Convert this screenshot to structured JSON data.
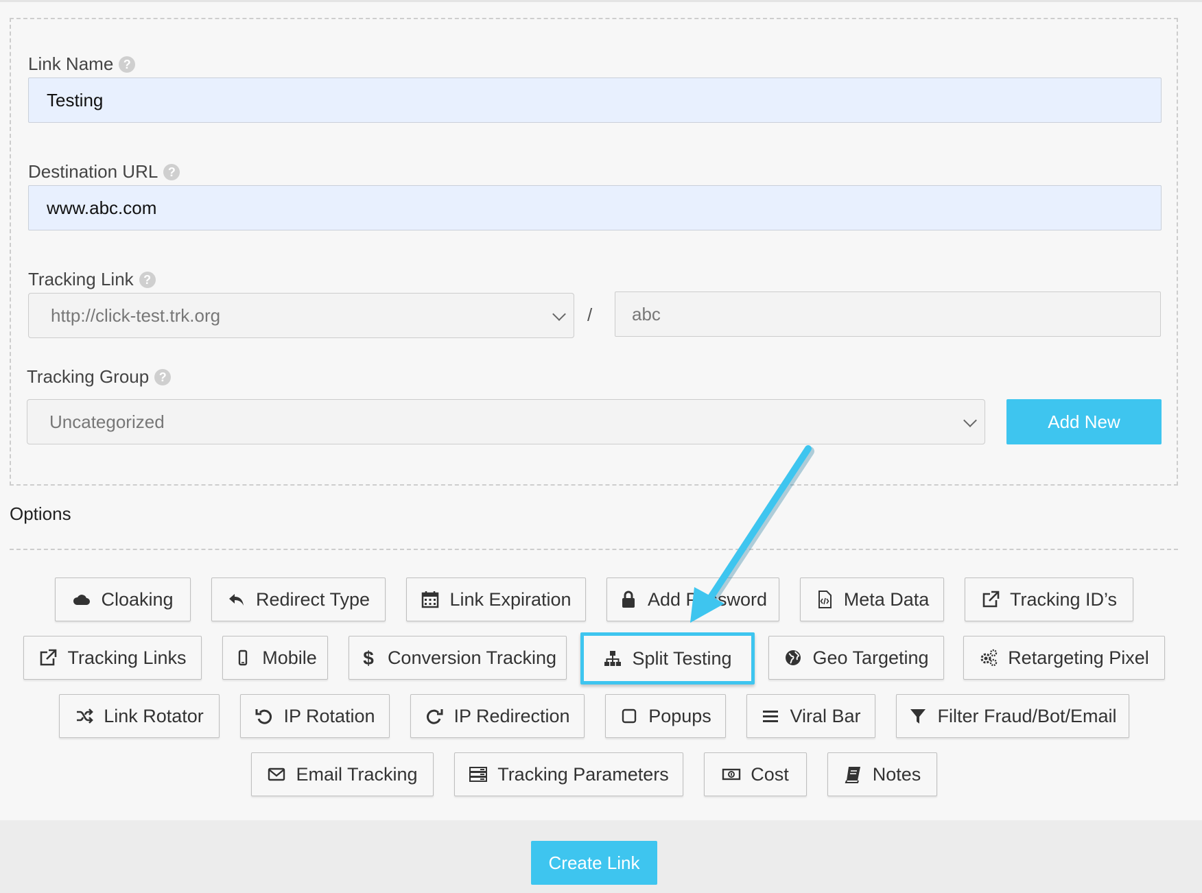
{
  "form": {
    "link_name": {
      "label": "Link Name",
      "value": "Testing"
    },
    "destination_url": {
      "label": "Destination URL",
      "value": "www.abc.com"
    },
    "tracking_link": {
      "label": "Tracking Link",
      "domain": "http://click-test.trk.org",
      "separator": "/",
      "slug": "abc"
    },
    "tracking_group": {
      "label": "Tracking Group",
      "selected": "Uncategorized",
      "add_new_label": "Add New"
    },
    "help_glyph": "?"
  },
  "options": {
    "title": "Options",
    "rows": [
      [
        {
          "label": "Cloaking",
          "icon": "cloud-icon"
        },
        {
          "label": "Redirect Type",
          "icon": "reply-icon"
        },
        {
          "label": "Link Expiration",
          "icon": "calendar-icon"
        },
        {
          "label": "Add Password",
          "icon": "lock-icon"
        },
        {
          "label": "Meta Data",
          "icon": "code-file-icon"
        },
        {
          "label": "Tracking ID’s",
          "icon": "external-link-icon"
        }
      ],
      [
        {
          "label": "Tracking Links",
          "icon": "external-link-icon"
        },
        {
          "label": "Mobile",
          "icon": "mobile-icon"
        },
        {
          "label": "Conversion Tracking",
          "icon": "dollar-icon"
        },
        {
          "label": "Split Testing",
          "icon": "sitemap-icon",
          "highlighted": true
        },
        {
          "label": "Geo Targeting",
          "icon": "globe-icon"
        },
        {
          "label": "Retargeting Pixel",
          "icon": "cogs-icon"
        }
      ],
      [
        {
          "label": "Link Rotator",
          "icon": "shuffle-icon"
        },
        {
          "label": "IP Rotation",
          "icon": "undo-icon"
        },
        {
          "label": "IP Redirection",
          "icon": "redo-icon"
        },
        {
          "label": "Popups",
          "icon": "square-icon"
        },
        {
          "label": "Viral Bar",
          "icon": "bars-icon"
        },
        {
          "label": "Filter Fraud/Bot/Email",
          "icon": "filter-icon"
        }
      ],
      [
        {
          "label": "Email Tracking",
          "icon": "envelope-icon"
        },
        {
          "label": "Tracking Parameters",
          "icon": "server-icon"
        },
        {
          "label": "Cost",
          "icon": "money-icon"
        },
        {
          "label": "Notes",
          "icon": "book-icon"
        }
      ]
    ]
  },
  "footer": {
    "create_label": "Create Link"
  },
  "colors": {
    "accent": "#3ec5ef",
    "input_fill": "#e8f0fe",
    "background": "#f7f7f7"
  }
}
